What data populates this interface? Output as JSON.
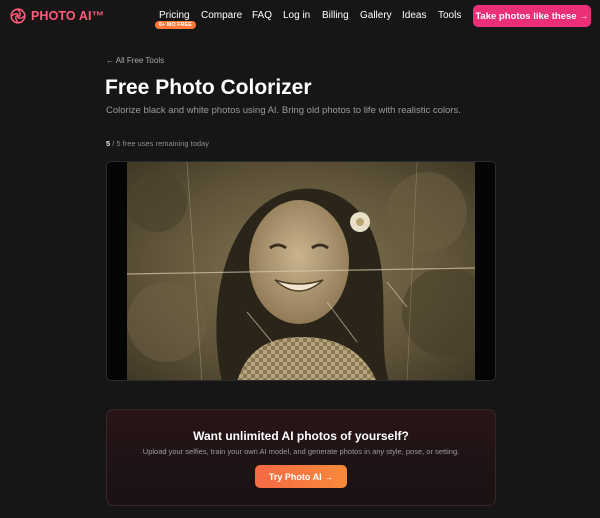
{
  "nav": {
    "logo_text": "PHOTO AI™",
    "links": [
      {
        "label": "Pricing",
        "name": "nav-link-pricing"
      },
      {
        "label": "Compare",
        "name": "nav-link-compare"
      },
      {
        "label": "FAQ",
        "name": "nav-link-faq"
      },
      {
        "label": "Log in",
        "name": "nav-link-login"
      },
      {
        "label": "Billing",
        "name": "nav-link-billing"
      },
      {
        "label": "Gallery",
        "name": "nav-link-gallery"
      },
      {
        "label": "Ideas",
        "name": "nav-link-ideas"
      },
      {
        "label": "Tools",
        "name": "nav-link-tools"
      }
    ],
    "pricing_badge": "6+ MO FREE",
    "cta_label": "Take photos like these →"
  },
  "main": {
    "back_link": "← All Free Tools",
    "title": "Free Photo Colorizer",
    "subtitle": "Colorize black and white photos using AI. Bring old photos to life with realistic colors.",
    "uses_count": "5",
    "uses_text": " / 5 free uses remaining today"
  },
  "promo": {
    "title": "Want unlimited AI photos of yourself?",
    "text": "Upload your selfies, train your own AI model, and generate photos in any style, pose, or setting.",
    "button_label": "Try Photo AI →"
  },
  "colors": {
    "brand": "#ff5b7a",
    "cta": "#ea2e77",
    "promo_button": "#f56a46",
    "background": "#161616"
  }
}
